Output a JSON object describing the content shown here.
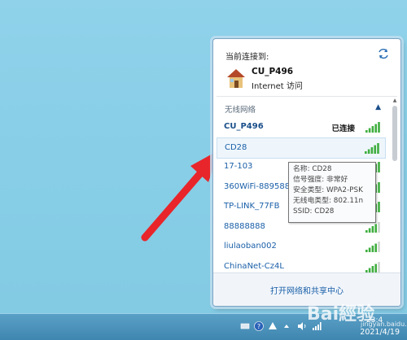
{
  "popup": {
    "currently_connected_label": "当前连接到:",
    "current_network": {
      "name": "CU_P496",
      "access": "Internet 访问"
    },
    "section_label": "无线网络",
    "networks": [
      {
        "name": "CU_P496",
        "status": "已连接",
        "signal": 5
      },
      {
        "name": "CD28",
        "status": "",
        "signal": 5
      },
      {
        "name": "17-103",
        "status": "",
        "signal": 5
      },
      {
        "name": "360WiFi-889588",
        "status": "",
        "signal": 5
      },
      {
        "name": "TP-LINK_77FB",
        "status": "",
        "signal": 5
      },
      {
        "name": "88888888",
        "status": "",
        "signal": 4
      },
      {
        "name": "liulaoban002",
        "status": "",
        "signal": 4
      },
      {
        "name": "ChinaNet-Cz4L",
        "status": "",
        "signal": 4
      }
    ],
    "footer_link": "打开网络和共享中心"
  },
  "tooltip": {
    "lines": [
      "名称: CD28",
      "信号强度: 非常好",
      "安全类型: WPA2-PSK",
      "无线电类型: 802.11n",
      "SSID: CD28"
    ]
  },
  "taskbar": {
    "time_partial": "23:4",
    "date": "2021/4/19"
  },
  "watermark": {
    "text": "Bai經验",
    "sub": "jingyan.baidu.com"
  },
  "colors": {
    "accent": "#1a5fa8",
    "arrow": "#e8252a",
    "signal": "#3fae3f"
  }
}
